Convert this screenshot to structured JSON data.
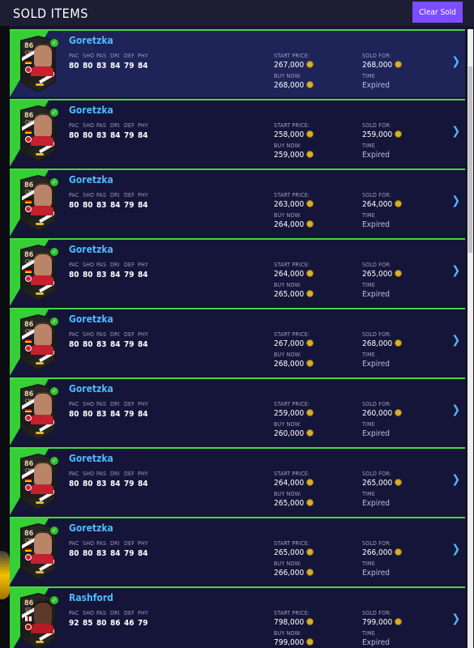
{
  "header": {
    "title": "SOLD ITEMS",
    "clear_label": "Clear Sold"
  },
  "labels": {
    "stats": [
      "PAC",
      "SHO",
      "PAS",
      "DRI",
      "DEF",
      "PHY"
    ],
    "start_price": "START PRICE:",
    "buy_now": "BUY NOW:",
    "sold_for": "SOLD FOR:",
    "time": "TIME"
  },
  "colors": {
    "accent_green": "#43d943",
    "name_blue": "#4fb9ff",
    "button_purple": "#7c4dff",
    "row_bg": "#15153a",
    "row_selected_bg": "#1e2358",
    "coin_gold": "#d6b02d"
  },
  "icons": {
    "sold_check": "checkmark-icon",
    "row_arrow": "chevron-right-icon",
    "price": "coin-icon"
  },
  "items": [
    {
      "name": "Goretzka",
      "rating": "86",
      "position": "CM",
      "stats": [
        "80",
        "80",
        "83",
        "84",
        "79",
        "84"
      ],
      "start_price": "267,000",
      "buy_now": "268,000",
      "sold_for": "268,000",
      "time": "Expired",
      "selected": true
    },
    {
      "name": "Goretzka",
      "rating": "86",
      "position": "CM",
      "stats": [
        "80",
        "80",
        "83",
        "84",
        "79",
        "84"
      ],
      "start_price": "258,000",
      "buy_now": "259,000",
      "sold_for": "259,000",
      "time": "Expired"
    },
    {
      "name": "Goretzka",
      "rating": "86",
      "position": "CM",
      "stats": [
        "80",
        "80",
        "83",
        "84",
        "79",
        "84"
      ],
      "start_price": "263,000",
      "buy_now": "264,000",
      "sold_for": "264,000",
      "time": "Expired"
    },
    {
      "name": "Goretzka",
      "rating": "86",
      "position": "CM",
      "stats": [
        "80",
        "80",
        "83",
        "84",
        "79",
        "84"
      ],
      "start_price": "264,000",
      "buy_now": "265,000",
      "sold_for": "265,000",
      "time": "Expired"
    },
    {
      "name": "Goretzka",
      "rating": "86",
      "position": "CM",
      "stats": [
        "80",
        "80",
        "83",
        "84",
        "79",
        "84"
      ],
      "start_price": "267,000",
      "buy_now": "268,000",
      "sold_for": "268,000",
      "time": "Expired"
    },
    {
      "name": "Goretzka",
      "rating": "86",
      "position": "CM",
      "stats": [
        "80",
        "80",
        "83",
        "84",
        "79",
        "84"
      ],
      "start_price": "259,000",
      "buy_now": "260,000",
      "sold_for": "260,000",
      "time": "Expired"
    },
    {
      "name": "Goretzka",
      "rating": "86",
      "position": "CM",
      "stats": [
        "80",
        "80",
        "83",
        "84",
        "79",
        "84"
      ],
      "start_price": "264,000",
      "buy_now": "265,000",
      "sold_for": "265,000",
      "time": "Expired"
    },
    {
      "name": "Goretzka",
      "rating": "86",
      "position": "CM",
      "stats": [
        "80",
        "80",
        "83",
        "84",
        "79",
        "84"
      ],
      "start_price": "265,000",
      "buy_now": "266,000",
      "sold_for": "266,000",
      "time": "Expired"
    },
    {
      "name": "Rashford",
      "rating": "86",
      "position": "ST",
      "stats": [
        "92",
        "85",
        "80",
        "86",
        "46",
        "79"
      ],
      "start_price": "798,000",
      "buy_now": "799,000",
      "sold_for": "799,000",
      "time": "Expired"
    }
  ]
}
